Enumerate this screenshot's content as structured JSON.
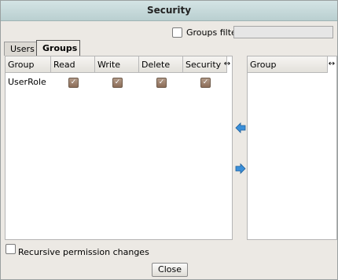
{
  "dialog": {
    "title": "Security"
  },
  "filter": {
    "checkbox_checked": false,
    "label": "Groups filter",
    "value": ""
  },
  "tabs": [
    {
      "label": "Users",
      "active": false
    },
    {
      "label": "Groups",
      "active": true
    }
  ],
  "permissions_table": {
    "columns": [
      "Group",
      "Read",
      "Write",
      "Delete",
      "Security"
    ],
    "rows": [
      {
        "group": "UserRole",
        "read": true,
        "write": true,
        "delete": true,
        "security": true
      }
    ]
  },
  "available_table": {
    "columns": [
      "Group"
    ],
    "rows": []
  },
  "recursive": {
    "label": "Recursive permission changes",
    "checked": false
  },
  "buttons": {
    "close": "Close"
  },
  "colors": {
    "titlebar": "#c5dadb",
    "dialog_bg": "#ece9e4",
    "check_fill": "#9c7f6b",
    "arrow": "#3a8fd9"
  }
}
